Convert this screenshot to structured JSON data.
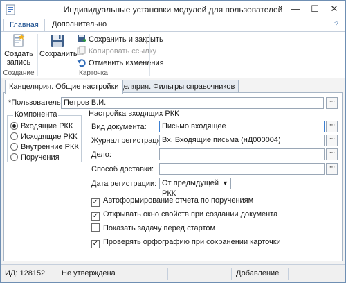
{
  "window": {
    "title": "Индивидуальные установки модулей для пользователей",
    "minimize": "—",
    "maximize": "☐",
    "close": "✕"
  },
  "ribbon": {
    "tabs": [
      {
        "label": "Главная"
      },
      {
        "label": "Дополнительно"
      }
    ],
    "help": "?",
    "groups": {
      "create": {
        "label": "Создание",
        "button": "Создать запись"
      },
      "card": {
        "label": "Карточка",
        "save": "Сохранить",
        "save_close": "Сохранить и закрыть",
        "copy_link": "Копировать ссылку",
        "undo": "Отменить изменения"
      }
    }
  },
  "page_tabs": [
    {
      "label": "Канцелярия. Общие настройки"
    },
    {
      "label": "Канцелярия. Фильтры справочников"
    }
  ],
  "form": {
    "user_label": "*Пользователь:",
    "user_value": "Петров В.И.",
    "components": {
      "title": "Компонента",
      "items": [
        {
          "label": "Входящие РКК",
          "selected": true
        },
        {
          "label": "Исходящие РКК",
          "selected": false
        },
        {
          "label": "Внутренние РКК",
          "selected": false
        },
        {
          "label": "Поручения",
          "selected": false
        }
      ]
    },
    "settings": {
      "title": "Настройка входящих РКК",
      "doc_type_label": "Вид документа:",
      "doc_type_value": "Письмо входящее",
      "journal_label": "Журнал регистрации:",
      "journal_value": "Вх. Входящие письма (нД000004)",
      "case_label": "Дело:",
      "case_value": "",
      "delivery_label": "Способ доставки:",
      "delivery_value": "",
      "reg_date_label": "Дата регистрации:",
      "reg_date_value": "От предыдущей РКК",
      "checkboxes": [
        {
          "label": "Автоформирование отчета по поручениям",
          "checked": true
        },
        {
          "label": "Открывать окно свойств при создании документа",
          "checked": true
        },
        {
          "label": "Показать задачу перед стартом",
          "checked": false
        },
        {
          "label": "Проверять орфографию при сохранении карточки",
          "checked": true
        }
      ]
    }
  },
  "status": {
    "id": "ИД: 128152",
    "state": "Не утверждена",
    "empty1": "",
    "mode": "Добавление"
  },
  "colors": {
    "accent": "#1c4f8f",
    "border": "#9aa7b6"
  }
}
